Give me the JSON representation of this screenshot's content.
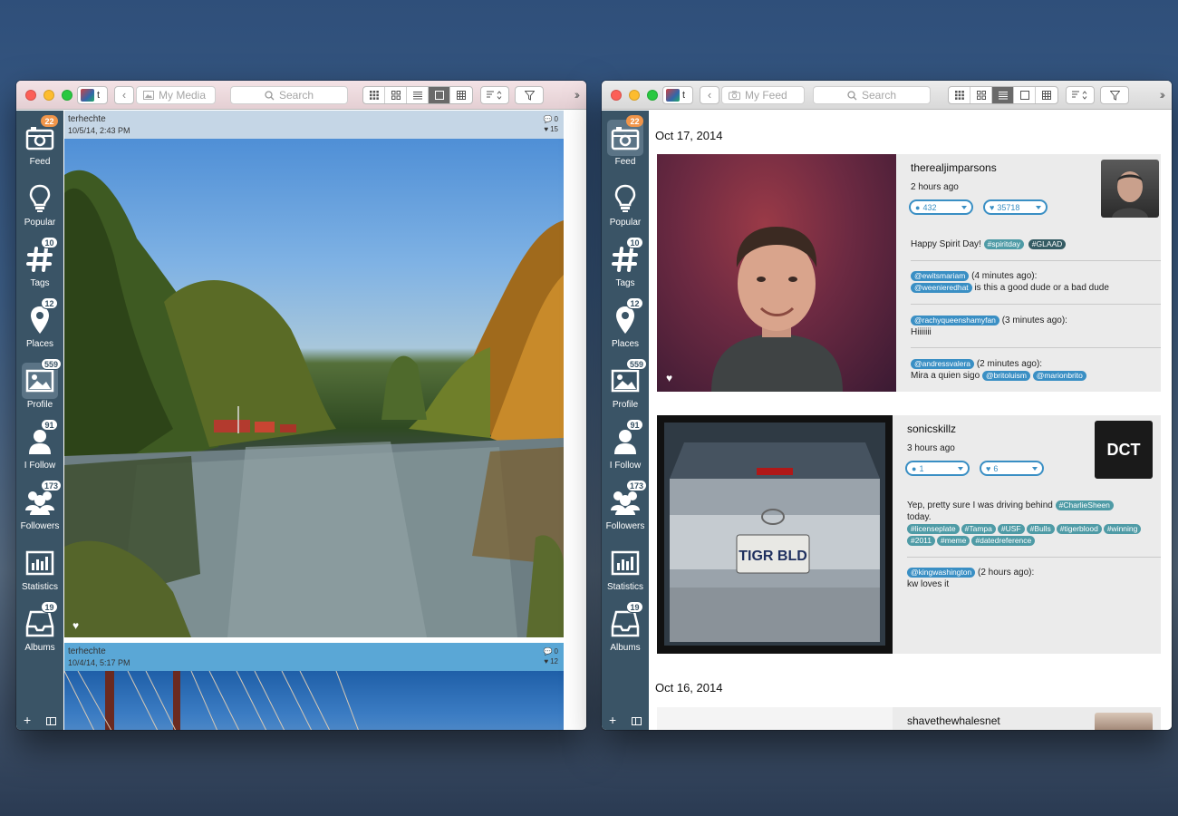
{
  "left_window": {
    "title": "My Media",
    "account_initial": "t",
    "search_placeholder": "Search",
    "view_active_index": 3,
    "nav": [
      {
        "label": "Feed",
        "badge": "22",
        "badge_color": "#f0954a",
        "icon": "camera-icon"
      },
      {
        "label": "Popular",
        "badge": "",
        "icon": "lightbulb-icon"
      },
      {
        "label": "Tags",
        "badge": "10",
        "icon": "hashtag-icon"
      },
      {
        "label": "Places",
        "badge": "12",
        "icon": "map-pin-icon"
      },
      {
        "label": "Profile",
        "badge": "559",
        "icon": "picture-icon",
        "active": true
      },
      {
        "label": "I Follow",
        "badge": "91",
        "icon": "person-icon"
      },
      {
        "label": "Followers",
        "badge": "173",
        "icon": "group-icon"
      },
      {
        "label": "Statistics",
        "badge": "",
        "icon": "bar-chart-icon"
      },
      {
        "label": "Albums",
        "badge": "19",
        "icon": "album-tray-icon"
      }
    ],
    "posts": [
      {
        "user": "terhechte",
        "date": "10/5/14, 2:43 PM",
        "comments": "0",
        "likes": "15",
        "header_color": "#c5d6e6"
      },
      {
        "user": "terhechte",
        "date": "10/4/14, 5:17 PM",
        "comments": "0",
        "likes": "12",
        "header_color": "#5aa7d6"
      }
    ]
  },
  "right_window": {
    "title": "My Feed",
    "account_initial": "t",
    "search_placeholder": "Search",
    "view_active_index": 2,
    "nav": [
      {
        "label": "Feed",
        "badge": "22",
        "badge_color": "#f0954a",
        "icon": "camera-icon",
        "active": true
      },
      {
        "label": "Popular",
        "badge": "",
        "icon": "lightbulb-icon"
      },
      {
        "label": "Tags",
        "badge": "10",
        "icon": "hashtag-icon"
      },
      {
        "label": "Places",
        "badge": "12",
        "icon": "map-pin-icon"
      },
      {
        "label": "Profile",
        "badge": "559",
        "icon": "picture-icon"
      },
      {
        "label": "I Follow",
        "badge": "91",
        "icon": "person-icon"
      },
      {
        "label": "Followers",
        "badge": "173",
        "icon": "group-icon"
      },
      {
        "label": "Statistics",
        "badge": "",
        "icon": "bar-chart-icon"
      },
      {
        "label": "Albums",
        "badge": "19",
        "icon": "album-tray-icon"
      }
    ],
    "date1": "Oct 17, 2014",
    "date2": "Oct 16, 2014",
    "card1": {
      "user": "therealjimparsons",
      "time": "2 hours ago",
      "comments": "432",
      "likes": "35718",
      "caption": "Happy Spirit Day!",
      "tags": [
        "#spiritday",
        "#GLAAD"
      ],
      "comments_list": [
        {
          "mention": "@ewitsmariam",
          "time": "(4 minutes ago):",
          "mention2": "@weenieredhat",
          "text": "is this a good dude or a bad dude"
        },
        {
          "mention": "@rachyqueenshamyfan",
          "time": "(3 minutes ago):",
          "text": "Hiiiiiii"
        },
        {
          "mention": "@andressvalera",
          "time": "(2 minutes ago):",
          "text": "Mira a quien sigo",
          "mentions_after": [
            "@britoluism",
            "@marionbrito"
          ]
        }
      ]
    },
    "card2": {
      "user": "sonicskillz",
      "time": "3 hours ago",
      "comments": "1",
      "likes": "6",
      "caption": "Yep, pretty sure I was driving behind",
      "caption_tag": "#CharlieSheen",
      "caption2": "today.",
      "tags": [
        "#licenseplate",
        "#Tampa",
        "#USF",
        "#Bulls",
        "#tigerblood",
        "#winning",
        "#2011",
        "#meme",
        "#datedreference"
      ],
      "avatar_text": "DCT",
      "plate_text": "TIGR BLD",
      "comment": {
        "mention": "@kingwashington",
        "time": "(2 hours ago):",
        "text": "kw loves it"
      }
    },
    "card3": {
      "user": "shavethewhalesnet"
    }
  },
  "colors": {
    "sidebar": "#3a5466",
    "badge_orange": "#f0954a",
    "accent_blue": "#3a8fc4",
    "tag_teal": "#4f9ba6"
  }
}
